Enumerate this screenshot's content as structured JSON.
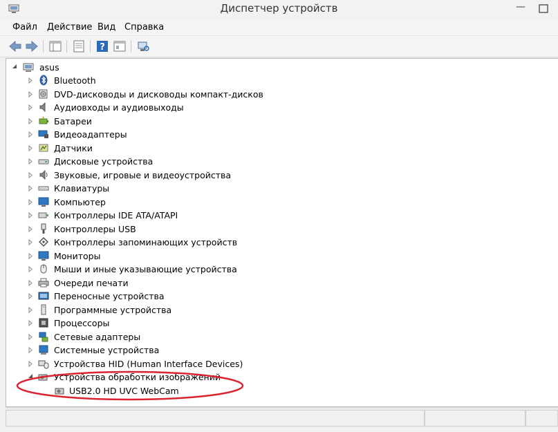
{
  "window": {
    "title": "Диспетчер устройств",
    "minimize_glyph": "—"
  },
  "menu": [
    "Файл",
    "Действие",
    "Вид",
    "Справка"
  ],
  "toolbar": [
    "back-arrow-icon",
    "forward-arrow-icon",
    "console-tree-icon",
    "properties-icon",
    "help-icon",
    "view-icon",
    "scan-hardware-icon"
  ],
  "tree": {
    "root": {
      "label": "asus",
      "icon": "computer-icon",
      "expanded": true
    },
    "categories": [
      {
        "label": "Bluetooth",
        "icon": "bluetooth-icon"
      },
      {
        "label": "DVD-дисководы и дисководы компакт-дисков",
        "icon": "dvd-drive-icon"
      },
      {
        "label": "Аудиовходы и аудиовыходы",
        "icon": "speaker-icon"
      },
      {
        "label": "Батареи",
        "icon": "battery-icon"
      },
      {
        "label": "Видеоадаптеры",
        "icon": "display-adapter-icon"
      },
      {
        "label": "Датчики",
        "icon": "sensor-icon"
      },
      {
        "label": "Дисковые устройства",
        "icon": "disk-drive-icon"
      },
      {
        "label": "Звуковые, игровые и видеоустройства",
        "icon": "sound-icon"
      },
      {
        "label": "Клавиатуры",
        "icon": "keyboard-icon"
      },
      {
        "label": "Компьютер",
        "icon": "computer-icon"
      },
      {
        "label": "Контроллеры IDE ATA/ATAPI",
        "icon": "ide-controller-icon"
      },
      {
        "label": "Контроллеры USB",
        "icon": "usb-icon"
      },
      {
        "label": "Контроллеры запоминающих устройств",
        "icon": "storage-controller-icon"
      },
      {
        "label": "Мониторы",
        "icon": "monitor-icon"
      },
      {
        "label": "Мыши и иные указывающие устройства",
        "icon": "mouse-icon"
      },
      {
        "label": "Очереди печати",
        "icon": "printer-icon"
      },
      {
        "label": "Переносные устройства",
        "icon": "portable-device-icon"
      },
      {
        "label": "Программные устройства",
        "icon": "software-device-icon"
      },
      {
        "label": "Процессоры",
        "icon": "processor-icon"
      },
      {
        "label": "Сетевые адаптеры",
        "icon": "network-adapter-icon"
      },
      {
        "label": "Системные устройства",
        "icon": "system-device-icon"
      },
      {
        "label": "Устройства HID (Human Interface Devices)",
        "icon": "hid-icon"
      },
      {
        "label": "Устройства обработки изображений",
        "icon": "imaging-device-icon",
        "expanded": true,
        "children": [
          {
            "label": "USB2.0 HD UVC WebCam",
            "icon": "webcam-icon"
          }
        ]
      }
    ]
  },
  "colors": {
    "highlight_ellipse": "#d9232e",
    "help_blue": "#2a6ab8",
    "monitor_blue": "#2f78c4",
    "selection": "#cce8ff"
  }
}
